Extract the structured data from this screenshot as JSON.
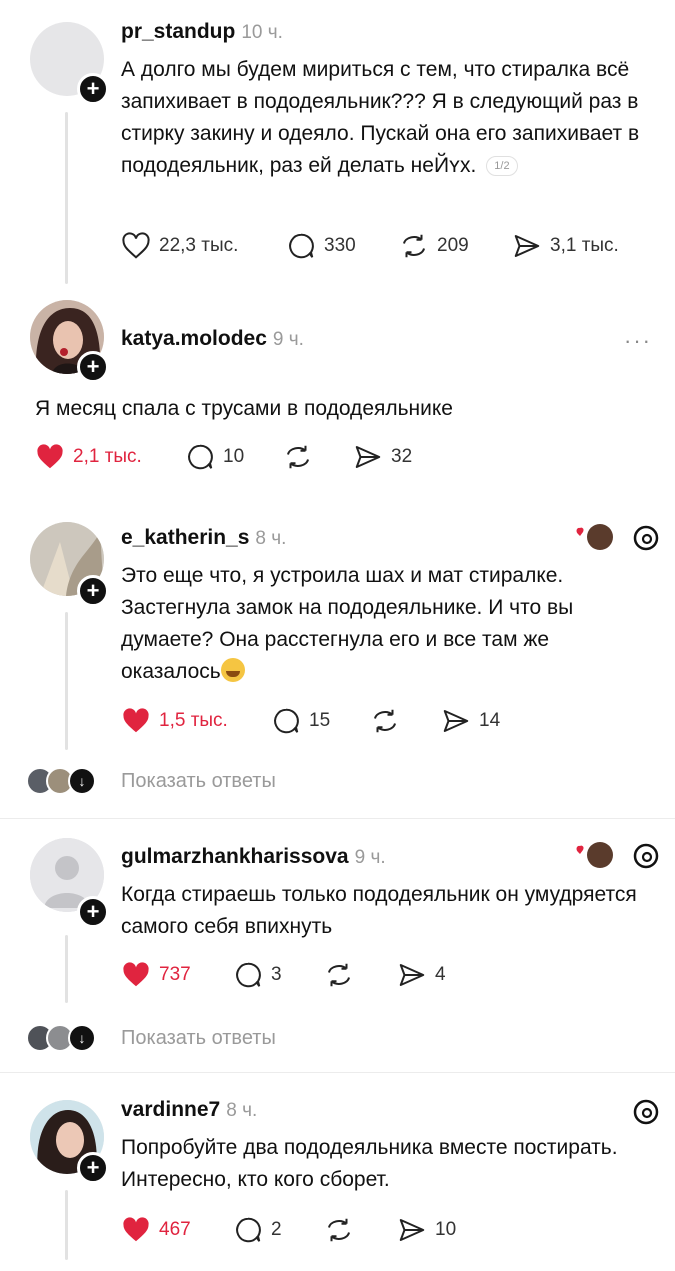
{
  "posts": [
    {
      "username": "pr_standup",
      "time": "10 ч.",
      "text": "А долго мы будем мириться с тем, что стиралка всё запихивает в пододеяльник??? Я в следующий раз в стирку закину и одеяло. Пускай она его запихивает в пододеяльник, раз ей делать неЙʏх.",
      "badge": "1/2",
      "likes": "22,3 тыс.",
      "comments": "330",
      "reposts": "209",
      "shares": "3,1 тыс."
    },
    {
      "username": "katya.molodec",
      "time": "9 ч.",
      "more": "···",
      "text": "Я месяц спала с трусами в пододеяльнике",
      "likes": "2,1 тыс.",
      "comments": "10",
      "shares": "32"
    },
    {
      "username": "e_katherin_s",
      "time": "8 ч.",
      "text": "Это еще что, я устроила шах и мат стиралке. Застегнула замок на пододеяльнике. И что вы думаете? Она расстегнула его и все там же оказалось",
      "likes": "1,5 тыс.",
      "comments": "15",
      "shares": "14",
      "show_replies": "Показать ответы"
    },
    {
      "username": "gulmarzhankharissova",
      "time": "9 ч.",
      "text": "Когда стираешь только пододеяльник он умудряется самого себя впихнуть",
      "likes": "737",
      "comments": "3",
      "shares": "4",
      "show_replies": "Показать ответы"
    },
    {
      "username": "vardinne7",
      "time": "8 ч.",
      "text": "Попробуйте два пододеяльника вместе постирать. Интересно, кто кого сборет.",
      "likes": "467",
      "comments": "2",
      "shares": "10"
    }
  ],
  "colors": {
    "liked": "#e0243f",
    "muted": "#9a9a9a",
    "text": "#101010"
  },
  "icons": [
    "heart-icon",
    "comment-icon",
    "repost-icon",
    "share-icon",
    "threads-logo-icon",
    "plus-icon",
    "chevron-down-icon",
    "more-icon"
  ]
}
